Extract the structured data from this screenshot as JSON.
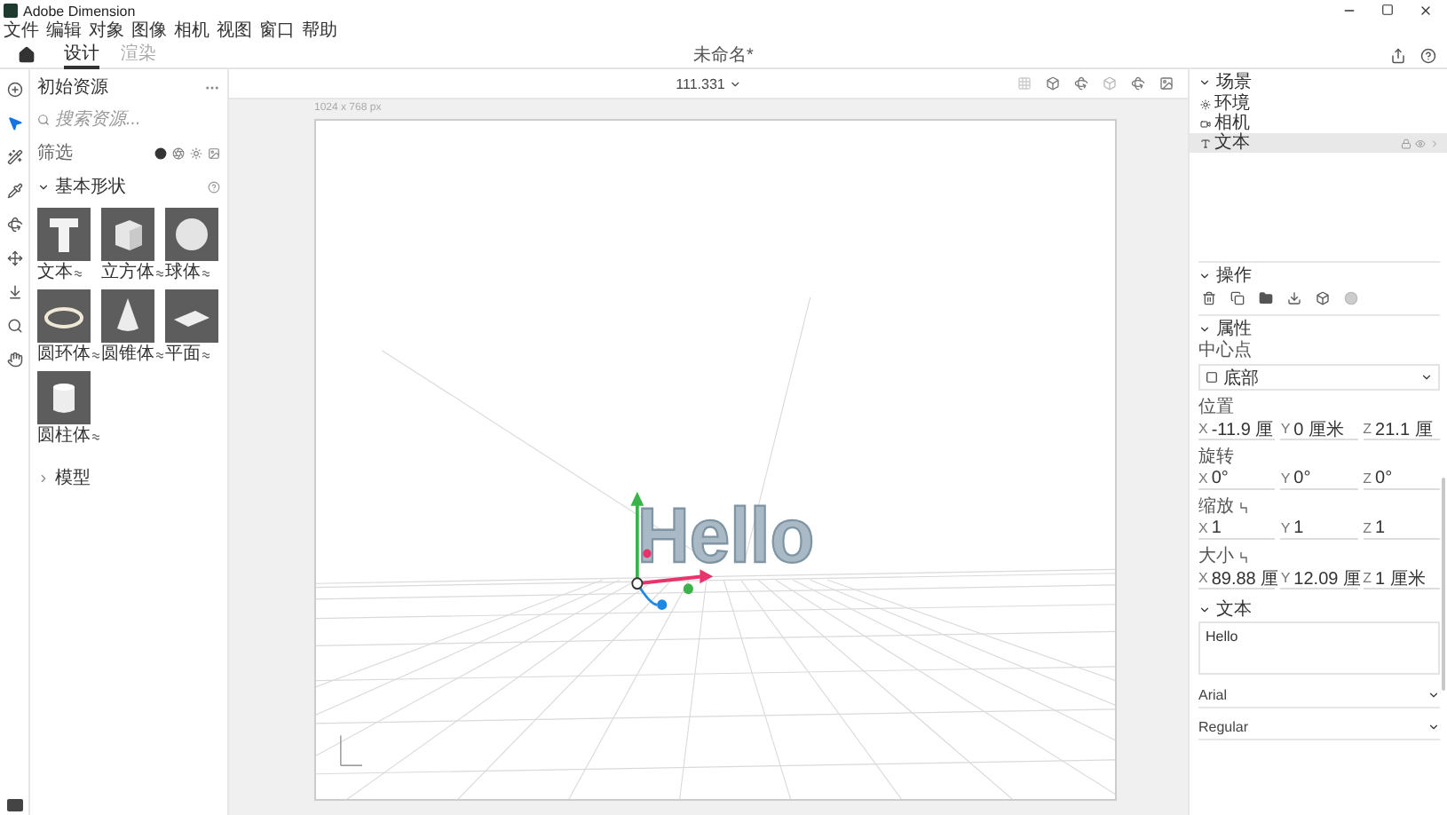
{
  "window": {
    "title": "Adobe Dimension"
  },
  "menu": [
    "文件",
    "编辑",
    "对象",
    "图像",
    "相机",
    "视图",
    "窗口",
    "帮助"
  ],
  "tabs": [
    {
      "label": "设计",
      "selected": true
    },
    {
      "label": "渲染",
      "selected": false
    }
  ],
  "document_title": "未命名*",
  "tools": [
    {
      "kind": "add",
      "selected": false
    },
    {
      "kind": "select",
      "selected": true
    },
    {
      "kind": "magic",
      "selected": false
    },
    {
      "kind": "sample",
      "selected": false
    },
    {
      "kind": "orbit",
      "selected": false
    },
    {
      "kind": "pan",
      "selected": false
    },
    {
      "kind": "dolly",
      "selected": false
    },
    {
      "kind": "zoom",
      "selected": false
    },
    {
      "kind": "hand",
      "selected": false
    }
  ],
  "assets": {
    "title": "初始资源",
    "search": {
      "placeholder": "搜索资源..."
    },
    "filter": "筛选",
    "section": "基本形状",
    "shapes": [
      {
        "kind": "text",
        "label": "文本"
      },
      {
        "kind": "cube",
        "label": "立方体"
      },
      {
        "kind": "sphere",
        "label": "球体"
      },
      {
        "kind": "torus",
        "label": "圆环体"
      },
      {
        "kind": "cone",
        "label": "圆锥体"
      },
      {
        "kind": "plane",
        "label": "平面"
      },
      {
        "kind": "cylinder",
        "label": "圆柱体"
      }
    ],
    "collapsed_section": "模型"
  },
  "zoom": "111.331",
  "canvas": {
    "size": "1024 x 768 px",
    "object_text": "Hello"
  },
  "scene": {
    "title": "场景",
    "items": [
      {
        "kind": "environment",
        "label": "环境",
        "selected": false
      },
      {
        "kind": "camera",
        "label": "相机",
        "selected": false
      },
      {
        "kind": "text",
        "label": "文本",
        "selected": true
      }
    ]
  },
  "actions": {
    "title": "操作"
  },
  "properties": {
    "title": "属性",
    "pivot_label": "中心点",
    "pivot_value": "底部",
    "groups": [
      {
        "label": "位置",
        "linked": false,
        "values": [
          {
            "axis": "X",
            "value": "-11.9 厘"
          },
          {
            "axis": "Y",
            "value": "0 厘米"
          },
          {
            "axis": "Z",
            "value": "21.1 厘"
          }
        ]
      },
      {
        "label": "旋转",
        "linked": false,
        "values": [
          {
            "axis": "X",
            "value": "0°"
          },
          {
            "axis": "Y",
            "value": "0°"
          },
          {
            "axis": "Z",
            "value": "0°"
          }
        ]
      },
      {
        "label": "缩放",
        "linked": true,
        "values": [
          {
            "axis": "X",
            "value": "1"
          },
          {
            "axis": "Y",
            "value": "1"
          },
          {
            "axis": "Z",
            "value": "1"
          }
        ]
      },
      {
        "label": "大小",
        "linked": true,
        "values": [
          {
            "axis": "X",
            "value": "89.88 厘"
          },
          {
            "axis": "Y",
            "value": "12.09 厘"
          },
          {
            "axis": "Z",
            "value": "1 厘米"
          }
        ]
      }
    ]
  },
  "text_panel": {
    "title": "文本",
    "content": "Hello",
    "font": "Arial",
    "style": "Regular"
  }
}
